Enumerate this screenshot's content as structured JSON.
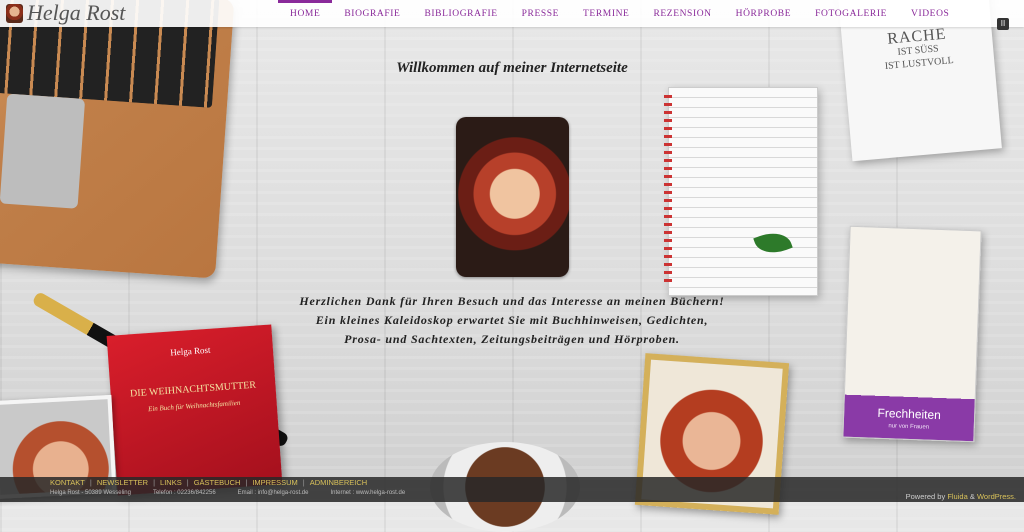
{
  "header": {
    "logo_text": "Helga Rost",
    "nav": [
      "HOME",
      "BIOGRAFIE",
      "BIBLIOGRAFIE",
      "PRESSE",
      "TERMINE",
      "REZENSION",
      "HÖRPROBE",
      "FOTOGALERIE",
      "VIDEOS"
    ],
    "pause_icon": "pause-icon",
    "pause_glyph": "II"
  },
  "main": {
    "welcome": "Willkommen auf meiner Internetseite",
    "intro_lines": [
      "Herzlichen Dank für Ihren Besuch und das Interesse an meinen Büchern!",
      "Ein kleines Kaleidoskop erwartet Sie mit Buchhinweisen, Gedichten,",
      "Prosa- und Sachtexten, Zeitungsbeiträgen und Hörproben."
    ]
  },
  "decor": {
    "book_red": {
      "author": "Helga Rost",
      "title": "DIE WEIHNACHTSMUTTER",
      "subtitle": "Ein Buch für Weihnachtsfamilien"
    },
    "book_rache": {
      "line1": "RACHE",
      "line2": "IST SÜSS",
      "line3": "IST LUSTVOLL"
    },
    "book_frech": {
      "title": "Frechheiten",
      "subtitle": "nur von Frauen"
    }
  },
  "footer": {
    "links": [
      "KONTAKT",
      "NEWSLETTER",
      "LINKS",
      "GÄSTEBUCH",
      "IMPRESSUM",
      "ADMINBEREICH"
    ],
    "contact": [
      "Helga Rost - 50389 Wesseling",
      "Telefon : 02236/842256",
      "Email : info@helga-rost.de",
      "Internet : www.helga-rost.de"
    ],
    "powered_prefix": "Powered by",
    "powered_fluida": "Fluida",
    "powered_and": "&",
    "powered_wp": "WordPress."
  },
  "colors": {
    "accent": "#8a2a9a",
    "footer_link": "#d8c15a"
  }
}
